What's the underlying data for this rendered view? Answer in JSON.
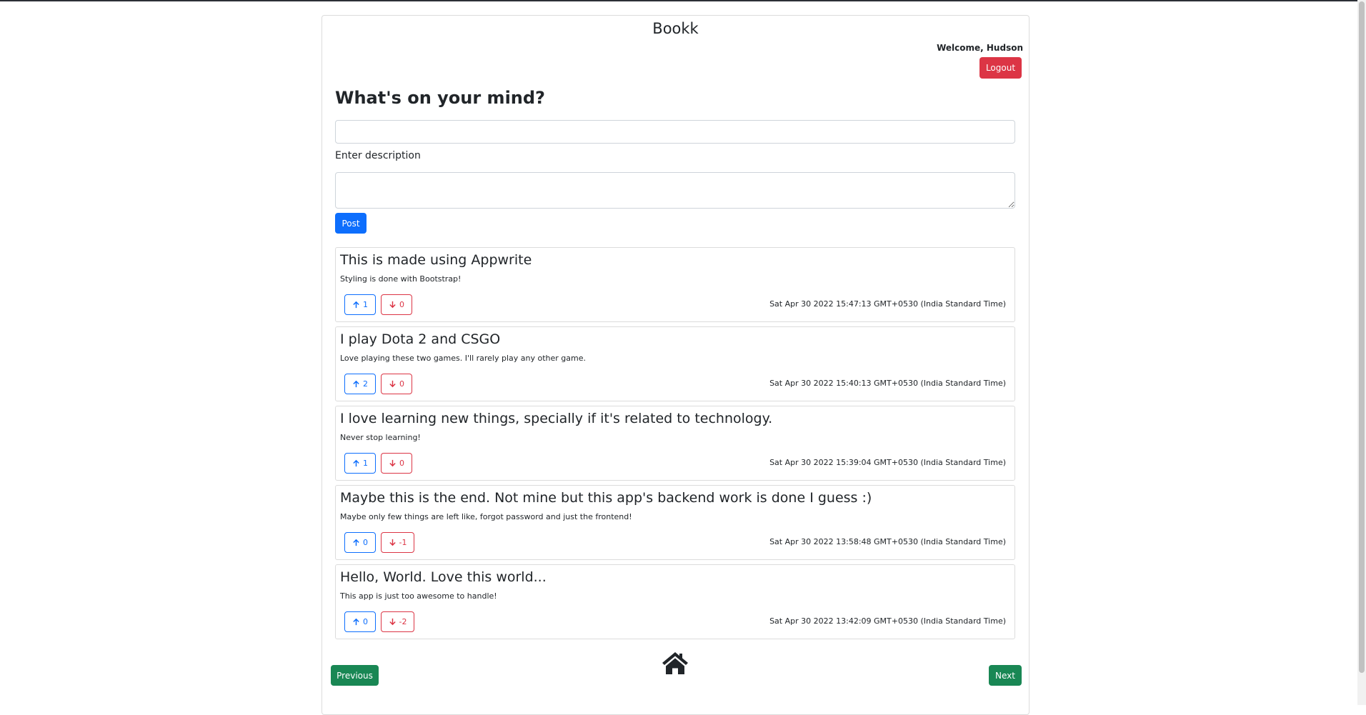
{
  "app": {
    "title": "Bookk",
    "welcome": "Welcome, Hudson",
    "logout_label": "Logout"
  },
  "composer": {
    "heading": "What's on your mind?",
    "title_value": "",
    "description_label": "Enter description",
    "description_value": "",
    "post_label": "Post"
  },
  "posts": [
    {
      "title": "This is made using Appwrite",
      "description": "Styling is done with Bootstrap!",
      "upvotes": "1",
      "downvotes": "0",
      "timestamp": "Sat Apr 30 2022 15:47:13 GMT+0530 (India Standard Time)"
    },
    {
      "title": "I play Dota 2 and CSGO",
      "description": "Love playing these two games. I'll rarely play any other game.",
      "upvotes": "2",
      "downvotes": "0",
      "timestamp": "Sat Apr 30 2022 15:40:13 GMT+0530 (India Standard Time)"
    },
    {
      "title": "I love learning new things, specially if it's related to technology.",
      "description": "Never stop learning!",
      "upvotes": "1",
      "downvotes": "0",
      "timestamp": "Sat Apr 30 2022 15:39:04 GMT+0530 (India Standard Time)"
    },
    {
      "title": "Maybe this is the end. Not mine but this app's backend work is done I guess :)",
      "description": "Maybe only few things are left like, forgot password and just the frontend!",
      "upvotes": "0",
      "downvotes": "-1",
      "timestamp": "Sat Apr 30 2022 13:58:48 GMT+0530 (India Standard Time)"
    },
    {
      "title": "Hello, World. Love this world...",
      "description": "This app is just too awesome to handle!",
      "upvotes": "0",
      "downvotes": "-2",
      "timestamp": "Sat Apr 30 2022 13:42:09 GMT+0530 (India Standard Time)"
    }
  ],
  "pagination": {
    "previous_label": "Previous",
    "next_label": "Next",
    "home_icon": "home-icon"
  },
  "colors": {
    "primary": "#0d6efd",
    "danger": "#dc3545",
    "success": "#198754"
  }
}
